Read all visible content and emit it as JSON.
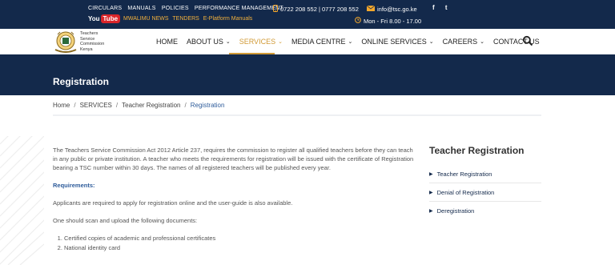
{
  "topbar": {
    "links_row1": [
      "CIRCULARS",
      "MANUALS",
      "POLICIES",
      "PERFORMANCE MANAGEMENT"
    ],
    "youtube_logo": {
      "you": "You",
      "tube": "Tube"
    },
    "links_row2": [
      "MWALIMU NEWS",
      "TENDERS",
      "E-Platform Manuals"
    ],
    "phone": "0722 208 552 | 0777 208 552",
    "email": "info@tsc.go.ke",
    "hours": "Mon - Fri 8.00 - 17.00",
    "social": [
      "f",
      "t"
    ]
  },
  "logo_text": [
    "Teachers",
    "Service",
    "Commission",
    "Kenya"
  ],
  "nav": {
    "items": [
      {
        "label": "HOME",
        "has_chevron": false
      },
      {
        "label": "ABOUT US",
        "has_chevron": true
      },
      {
        "label": "SERVICES",
        "has_chevron": true,
        "active": true
      },
      {
        "label": "MEDIA CENTRE",
        "has_chevron": true
      },
      {
        "label": "ONLINE SERVICES",
        "has_chevron": true
      },
      {
        "label": "CAREERS",
        "has_chevron": true
      },
      {
        "label": "CONTACT US",
        "has_chevron": false
      }
    ],
    "search_icon": "search-icon",
    "active_color": "#d19a36"
  },
  "banner": {
    "title": "Registration",
    "bg_color": "#13294b"
  },
  "breadcrumb": [
    "Home",
    "SERVICES",
    "Teacher Registration",
    "Registration"
  ],
  "content": {
    "intro": "The Teachers Service Commission Act 2012 Article 237, requires the commission to register all qualified teachers before they can teach in any public or private institution. A teacher who meets the requirements for registration will be issued with the certificate of Registration bearing a TSC number within 30 days. The names of all registered teachers will be published every year.",
    "requirements_heading": "Requirements:",
    "apply_text": "Applicants are required to apply for registration online and the user-guide is also available.",
    "scan_text": "One should scan and upload the following documents:",
    "documents": [
      "Certified copies of academic and professional certificates",
      "National identity card"
    ]
  },
  "sidebar": {
    "title": "Teacher Registration",
    "items": [
      "Teacher Registration",
      "Denial of Registration",
      "Deregistration"
    ]
  }
}
